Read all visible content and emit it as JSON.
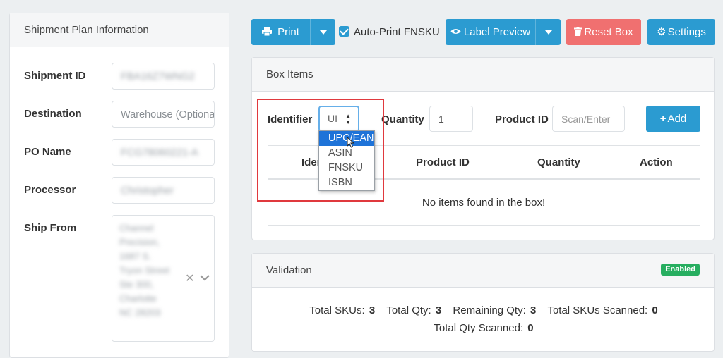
{
  "shipment_panel": {
    "title": "Shipment Plan Information",
    "fields": [
      {
        "label": "Shipment ID",
        "value": "FBA16Z7WNG2"
      },
      {
        "label": "Destination",
        "placeholder": "Warehouse (Optional)"
      },
      {
        "label": "PO Name",
        "value": "FCG78060221-A"
      },
      {
        "label": "Processor",
        "value": "Christopher"
      }
    ],
    "ship_from": {
      "label": "Ship From",
      "value": "Channel\nPrecision,\n1687 S.\nTryon Street\nSte 300,\nCharlotte\nNC 28203"
    }
  },
  "toolbar": {
    "print_label": "Print",
    "auto_print_label": "Auto-Print FNSKU",
    "auto_print_checked": true,
    "label_preview_label": "Label Preview",
    "reset_box_label": "Reset Box",
    "settings_label": "Settings"
  },
  "box_items": {
    "title": "Box Items",
    "identifier_label": "Identifier",
    "identifier_selected_display": "UI",
    "identifier_options": [
      "UPC/EAN",
      "ASIN",
      "FNSKU",
      "ISBN"
    ],
    "quantity_label": "Quantity",
    "quantity_value": "1",
    "product_id_label": "Product ID",
    "product_id_placeholder": "Scan/Enter",
    "add_label": "Add",
    "columns": [
      "Identifier",
      "Product ID",
      "Quantity",
      "Action"
    ],
    "empty_message": "No items found in the box!"
  },
  "validation": {
    "title": "Validation",
    "badge": "Enabled",
    "stats": [
      {
        "label": "Total SKUs:",
        "value": "3"
      },
      {
        "label": "Total Qty:",
        "value": "3"
      },
      {
        "label": "Remaining Qty:",
        "value": "3"
      },
      {
        "label": "Total SKUs Scanned:",
        "value": "0"
      }
    ],
    "stats_line2": {
      "label": "Total Qty Scanned:",
      "value": "0"
    }
  },
  "colors": {
    "primary": "#2b9bd1",
    "danger": "#f07070",
    "success": "#27ae60",
    "highlight": "#e0393e"
  }
}
